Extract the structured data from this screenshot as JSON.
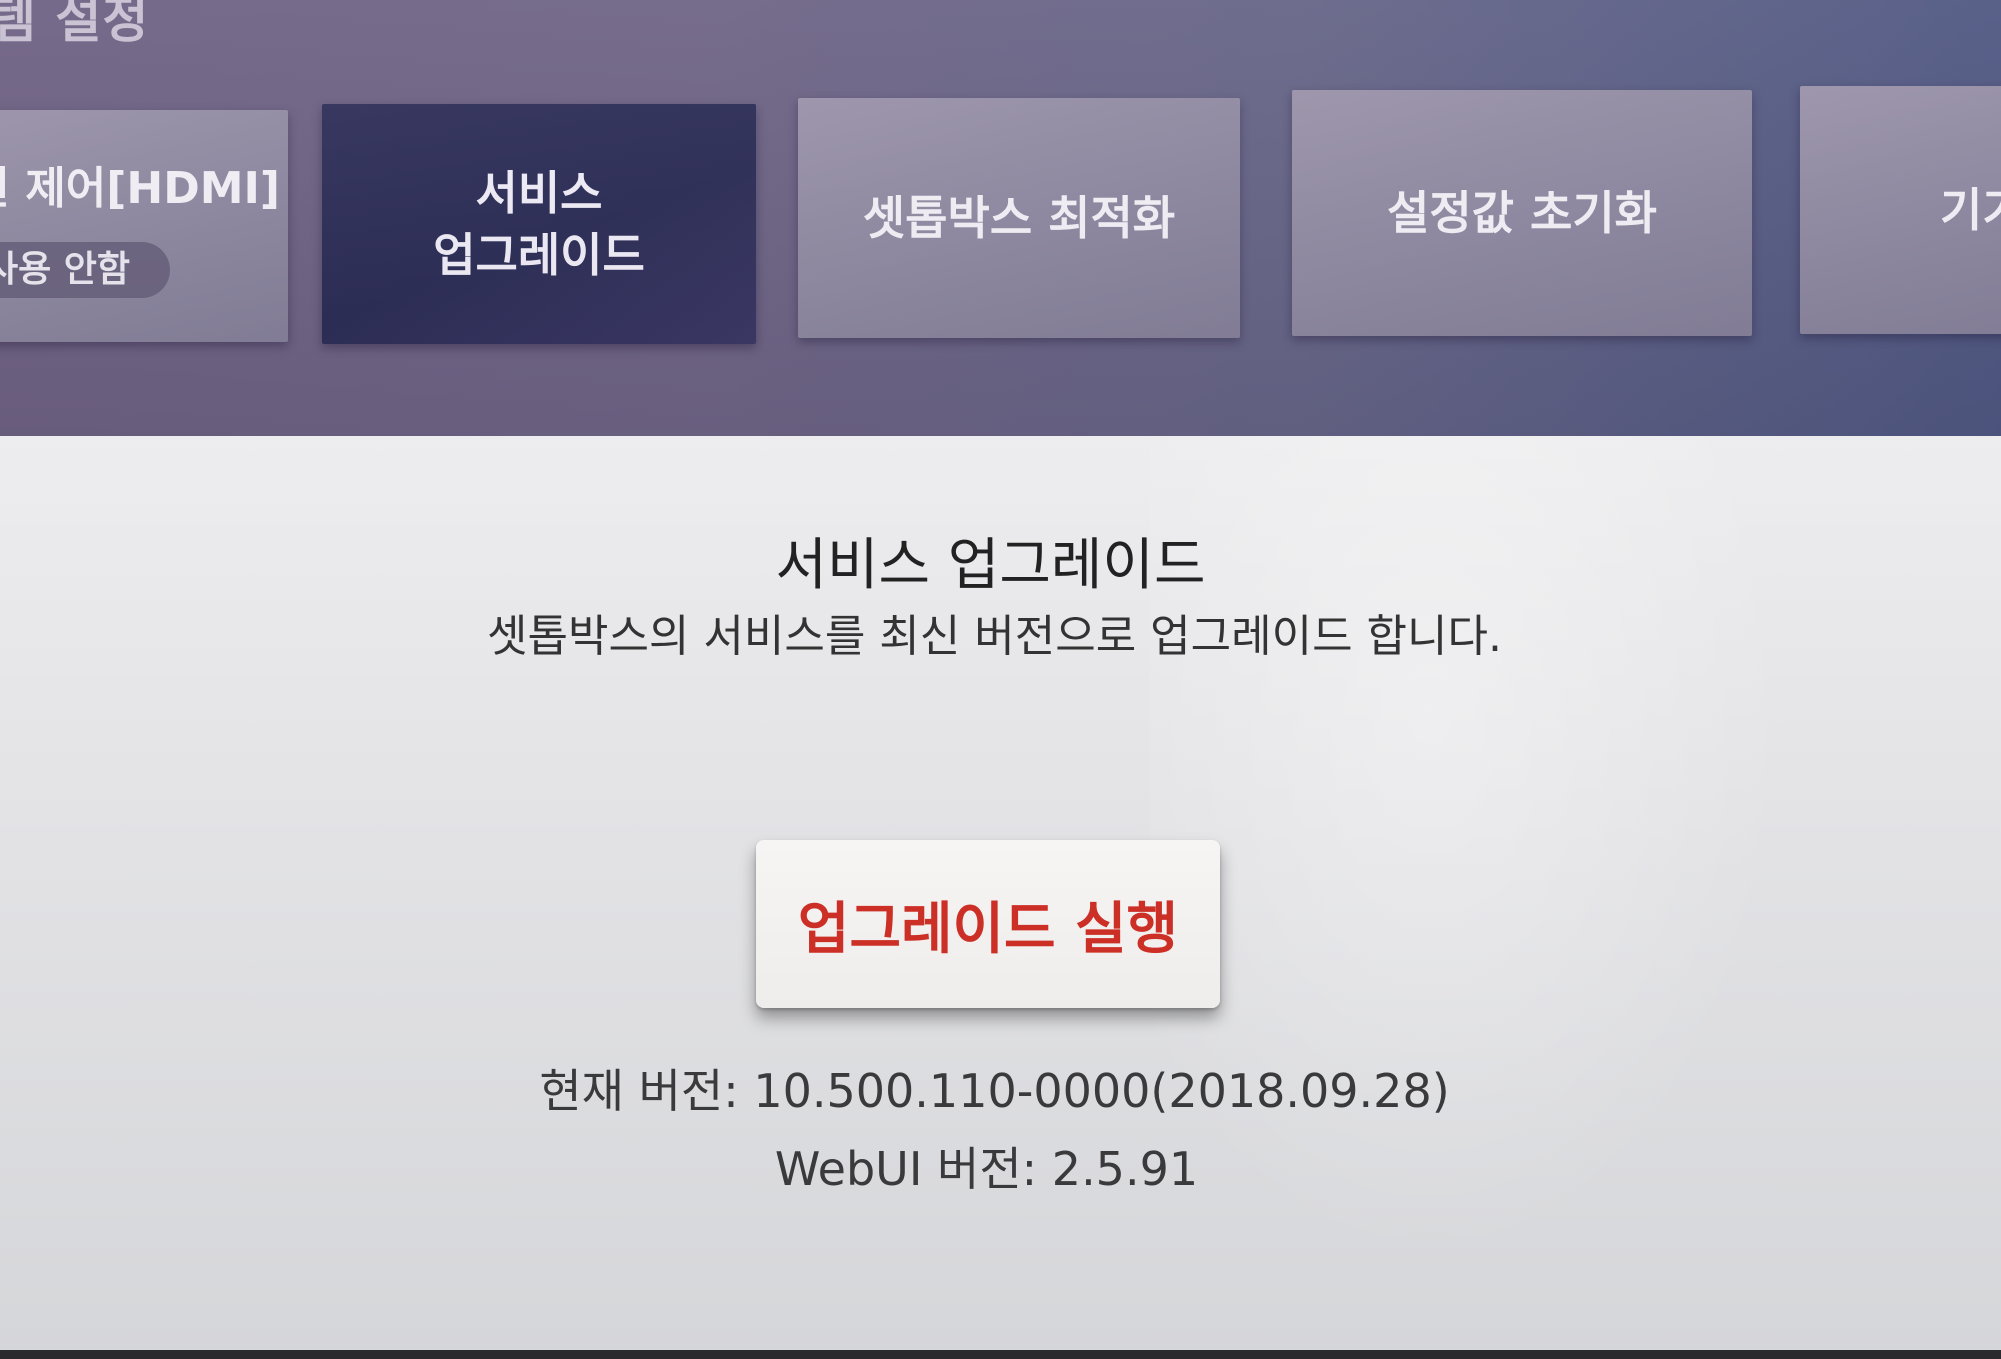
{
  "header": {
    "title": "템 설정"
  },
  "menu": {
    "items": [
      {
        "label": "원 제어[HDMI]",
        "status": "사용 안함"
      },
      {
        "label": "서비스\n업그레이드"
      },
      {
        "label": "셋톱박스 최적화"
      },
      {
        "label": "설정값 초기화"
      },
      {
        "label": "기기"
      }
    ],
    "selected_index": 1
  },
  "main": {
    "title": "서비스 업그레이드",
    "description": "셋톱박스의 서비스를 최신 버전으로 업그레이드 합니다.",
    "upgrade_button_label": "업그레이드 실행",
    "current_version": "현재 버전: 10.500.110-0000(2018.09.28)",
    "webui_version": "WebUI 버전: 2.5.91"
  },
  "colors": {
    "header_bg": "#6e6385",
    "selected_card_bg": "#2d2e58",
    "card_bg": "#928ca4",
    "button_text": "#cc2f25"
  }
}
